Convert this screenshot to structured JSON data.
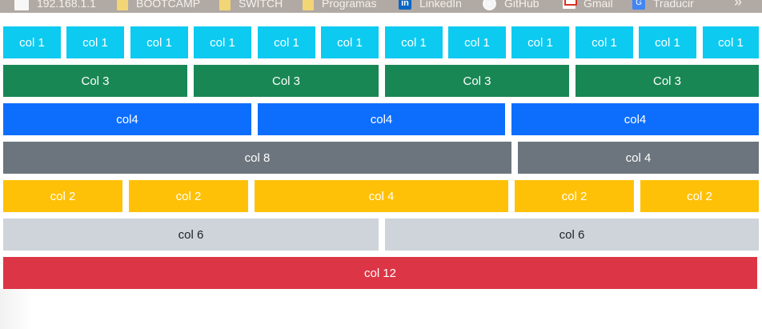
{
  "bookmarks": [
    {
      "label": "192.168.1.1",
      "icon": "page-icon"
    },
    {
      "label": "BOOTCAMP",
      "icon": "folder-icon"
    },
    {
      "label": "SWITCH",
      "icon": "folder-icon"
    },
    {
      "label": "Programas",
      "icon": "folder-icon"
    },
    {
      "label": "LinkedIn",
      "icon": "linkedin-icon"
    },
    {
      "label": "GitHub",
      "icon": "github-icon"
    },
    {
      "label": "Gmail",
      "icon": "gmail-icon"
    },
    {
      "label": "Traducir",
      "icon": "translate-icon"
    }
  ],
  "bookmarks_more": "»",
  "linkedin_glyph": "in",
  "translate_glyph": "G",
  "rows": {
    "row1": {
      "color": "#0dcaf0",
      "cols": [
        "col 1",
        "col 1",
        "col 1",
        "col 1",
        "col 1",
        "col 1",
        "col 1",
        "col 1",
        "col 1",
        "col 1",
        "col 1",
        "col 1"
      ]
    },
    "row2": {
      "color": "#198754",
      "cols": [
        "Col 3",
        "Col 3",
        "Col 3",
        "Col 3"
      ]
    },
    "row3": {
      "color": "#0d6efd",
      "cols": [
        "col4",
        "col4",
        "col4"
      ]
    },
    "row4": {
      "color": "#6c757d",
      "cols": [
        "col 8",
        "col 4"
      ]
    },
    "row5": {
      "color": "#ffc107",
      "cols": [
        "col 2",
        "col 2",
        "col 4",
        "col 2",
        "col 2"
      ]
    },
    "row6": {
      "color": "#ced4da",
      "cols": [
        "col 6",
        "col 6"
      ]
    },
    "row7": {
      "color": "#dc3545",
      "cols": [
        "col 12"
      ]
    }
  }
}
